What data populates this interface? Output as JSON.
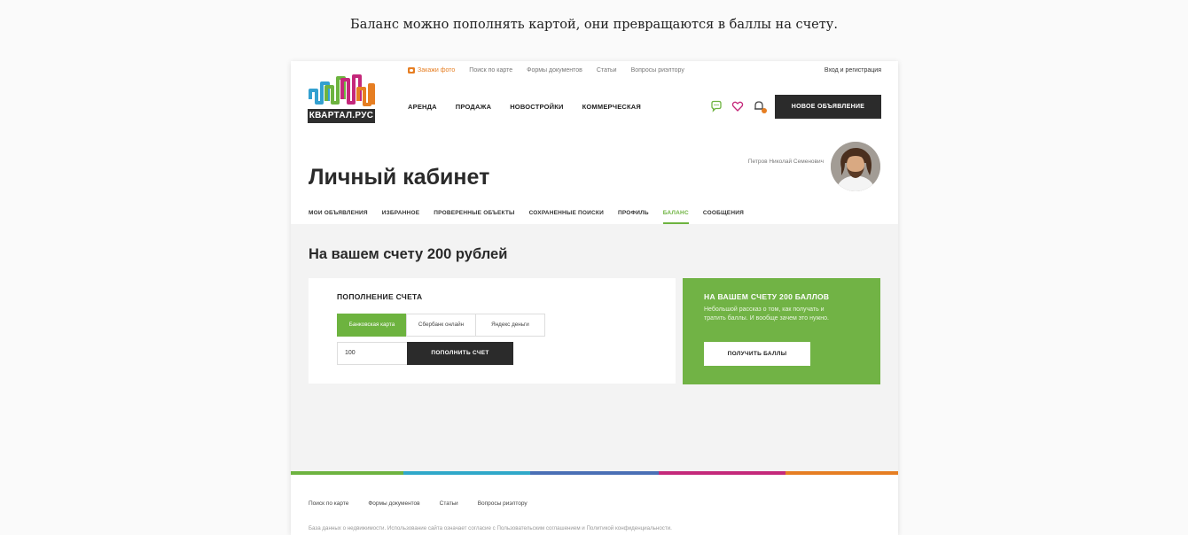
{
  "caption": "Баланс можно пополнять картой, они превращаются в баллы на счету.",
  "logo": {
    "text": "КВАРТАЛ.РУС"
  },
  "topnav": {
    "order_photo": "Закажи фото",
    "items": [
      "Поиск по карте",
      "Формы документов",
      "Статьи",
      "Вопросы риэлтору"
    ],
    "login": "Вход и регистрация"
  },
  "mainnav": [
    "АРЕНДА",
    "ПРОДАЖА",
    "НОВОСТРОЙКИ",
    "КОММЕРЧЕСКАЯ"
  ],
  "new_ad_button": "НОВОЕ ОБЪЯВЛЕНИЕ",
  "user": {
    "name": "Петров Николай Семенович"
  },
  "page_title": "Личный кабинет",
  "tabs": [
    {
      "label": "МОИ ОБЪЯВЛЕНИЯ"
    },
    {
      "label": "ИЗБРАННОЕ"
    },
    {
      "label": "ПРОВЕРЕННЫЕ ОБЪЕКТЫ"
    },
    {
      "label": "СОХРАНЕННЫЕ ПОИСКИ"
    },
    {
      "label": "ПРОФИЛЬ"
    },
    {
      "label": "БАЛАНС"
    },
    {
      "label": "СООБЩЕНИЯ"
    }
  ],
  "active_tab": "БАЛАНС",
  "balance_title": "На вашем счету 200 рублей",
  "topup": {
    "title": "ПОПОЛНЕНИЕ СЧЕТА",
    "methods": [
      "Банковская карта",
      "Сбербанк онлайн",
      "Яндекс деньги"
    ],
    "active_method": "Банковская карта",
    "amount_value": "100",
    "button": "ПОПОЛНИТЬ СЧЕТ"
  },
  "points": {
    "title": "НА ВАШЕМ СЧЕТУ 200 БАЛЛОВ",
    "text": "Небольшой рассказ о том, как получать и тратить баллы. И вообще зачем это нужно.",
    "button": "ПОЛУЧИТЬ БАЛЛЫ"
  },
  "footer": {
    "nav": [
      "Поиск по карте",
      "Формы документов",
      "Статьи",
      "Вопросы риэлтору"
    ],
    "text": "База данных о недвижимости. Использование сайта означает согласие с Пользовательским соглашением и Политикой конфиденциальности."
  },
  "colors": {
    "accent_green": "#6db33f",
    "points_green": "#71b345",
    "dark_button": "#2b2b2b",
    "orange": "#e67e22",
    "stripe": [
      "#6db33f",
      "#2fa8c9",
      "#4a6fb5",
      "#c4287a",
      "#e67e22"
    ]
  },
  "icons": [
    "camera-icon",
    "chat-icon",
    "heart-icon",
    "bell-icon"
  ]
}
